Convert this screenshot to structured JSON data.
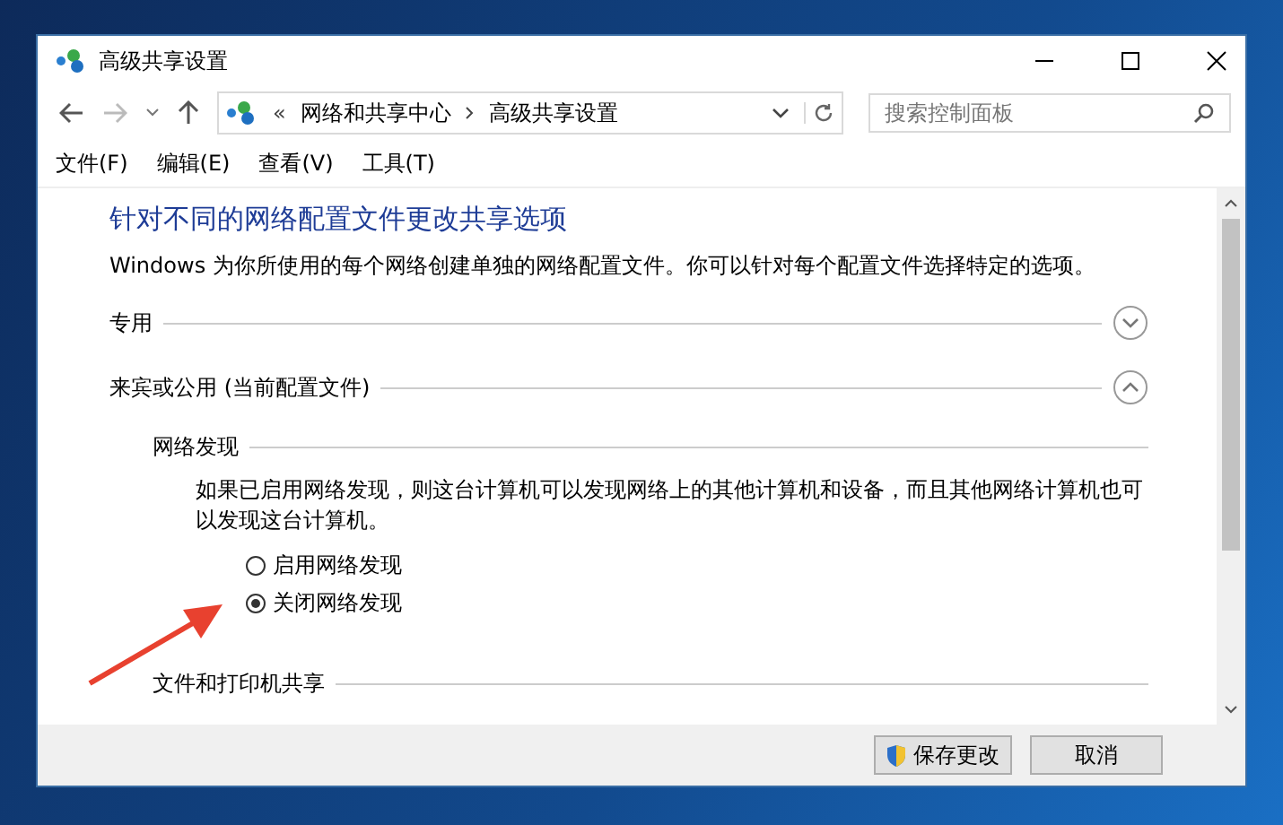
{
  "window": {
    "title": "高级共享设置"
  },
  "address": {
    "prefix": "«",
    "crumbs": [
      "网络和共享中心",
      "高级共享设置"
    ]
  },
  "search": {
    "placeholder": "搜索控制面板"
  },
  "menu": [
    "文件(F)",
    "编辑(E)",
    "查看(V)",
    "工具(T)"
  ],
  "heading": "针对不同的网络配置文件更改共享选项",
  "intro": "Windows 为你所使用的每个网络创建单独的网络配置文件。你可以针对每个配置文件选择特定的选项。",
  "profiles": [
    {
      "label": "专用",
      "expanded": false
    },
    {
      "label": "来宾或公用 (当前配置文件)",
      "expanded": true,
      "sections": [
        {
          "title": "网络发现",
          "description": "如果已启用网络发现，则这台计算机可以发现网络上的其他计算机和设备，而且其他网络计算机也可以发现这台计算机。",
          "options": [
            {
              "label": "启用网络发现",
              "selected": false
            },
            {
              "label": "关闭网络发现",
              "selected": true
            }
          ]
        },
        {
          "title": "文件和打印机共享"
        }
      ]
    }
  ],
  "buttons": [
    {
      "label": "保存更改",
      "kind": "admin"
    },
    {
      "label": "取消",
      "kind": "plain"
    }
  ]
}
